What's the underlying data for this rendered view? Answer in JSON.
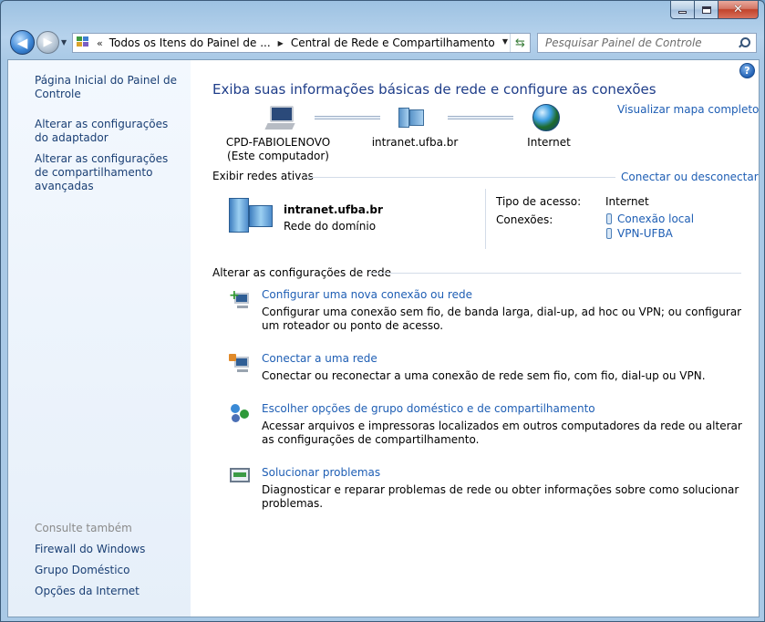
{
  "window": {
    "controls": {
      "minimize": "",
      "maximize": "",
      "close": "✕"
    }
  },
  "nav": {
    "back_icon": "back-arrow-icon",
    "forward_icon": "forward-arrow-icon",
    "address_prefix": "«",
    "breadcrumb": [
      "Todos os Itens do Painel de ...",
      "Central de Rede e Compartilhamento"
    ],
    "search_placeholder": "Pesquisar Painel de Controle"
  },
  "sidebar": {
    "items": [
      "Página Inicial do Painel de Controle",
      "Alterar as configurações do adaptador",
      "Alterar as configurações de compartilhamento avançadas"
    ],
    "see_also_title": "Consulte também",
    "see_also": [
      "Firewall do Windows",
      "Grupo Doméstico",
      "Opções da Internet"
    ]
  },
  "main": {
    "title": "Exiba suas informações básicas de rede e configure as conexões",
    "full_map_link": "Visualizar mapa completo",
    "map": {
      "computer_name": "CPD-FABIOLENOVO",
      "computer_sub": "(Este computador)",
      "network": "intranet.ufba.br",
      "internet": "Internet"
    },
    "active_networks": {
      "header": "Exibir redes ativas",
      "connect_link": "Conectar ou desconectar",
      "network_name": "intranet.ufba.br",
      "network_type": "Rede do domínio",
      "access_type_label": "Tipo de acesso:",
      "access_type_value": "Internet",
      "connections_label": "Conexões:",
      "connections": [
        "Conexão local",
        "VPN-UFBA"
      ]
    },
    "change_settings": {
      "header": "Alterar as configurações de rede",
      "tasks": [
        {
          "link": "Configurar uma nova conexão ou rede",
          "desc": "Configurar uma conexão sem fio, de banda larga, dial-up, ad hoc ou VPN; ou configurar um roteador ou ponto de acesso."
        },
        {
          "link": "Conectar a uma rede",
          "desc": "Conectar ou reconectar a uma conexão de rede sem fio, com fio, dial-up ou VPN."
        },
        {
          "link": "Escolher opções de grupo doméstico e de compartilhamento",
          "desc": "Acessar arquivos e impressoras localizados em outros computadores da rede ou alterar as configurações de compartilhamento."
        },
        {
          "link": "Solucionar problemas",
          "desc": "Diagnosticar e reparar problemas de rede ou obter informações sobre como solucionar problemas."
        }
      ]
    },
    "help_icon": "?"
  }
}
